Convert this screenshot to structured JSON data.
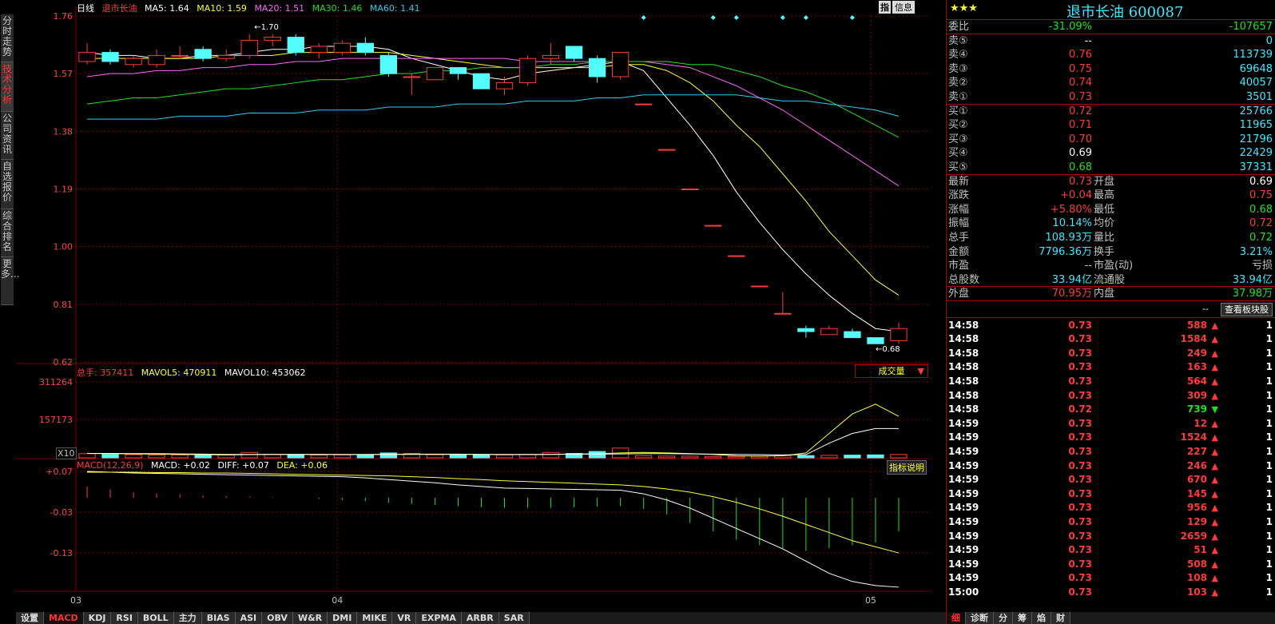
{
  "left_tabs": [
    {
      "label": "分时走势",
      "active": false
    },
    {
      "label": "技术分析",
      "active": true
    },
    {
      "label": "公司资讯",
      "active": false
    },
    {
      "label": "自选报价",
      "active": false
    },
    {
      "label": "综合排名",
      "active": false
    },
    {
      "label": "更多...",
      "active": false
    }
  ],
  "main_legend": {
    "period": "日线",
    "name": "退市长油",
    "ma5": "MA5: 1.64",
    "ma10": "MA10: 1.59",
    "ma20": "MA20: 1.51",
    "ma30": "MA30: 1.46",
    "ma60": "MA60: 1.41"
  },
  "toolbar": {
    "zhi_label": "指",
    "info_label": "信息"
  },
  "vol_legend": {
    "total": "总手: 357411",
    "mavol5": "MAVOL5: 470911",
    "mavol10": "MAVOL10: 453062",
    "dropdown": "成交量",
    "x10": "X10"
  },
  "macd_legend": {
    "params": "MACD(12,26,9)",
    "macd": "MACD: +0.02",
    "diff": "DIFF: +0.07",
    "dea": "DEA: +0.06",
    "help_button": "指标说明"
  },
  "annotations": {
    "high": "←1.70",
    "low": "←0.68"
  },
  "colors": {
    "up": "#ff3b3b",
    "down": "#54fcfc",
    "ma5": "#ffffff",
    "ma10": "#ffff33",
    "ma20": "#ff66ff",
    "ma30": "#22e022",
    "ma60": "#33ccee",
    "grid": "#800000"
  },
  "chart_data": [
    {
      "type": "candlestick",
      "yaxis_ticks": [
        "1.76",
        "1.57",
        "1.38",
        "1.19",
        "1.00",
        "0.81",
        "0.62"
      ],
      "ylim": [
        0.62,
        1.76
      ],
      "xaxis_ticks": [
        "03",
        "04",
        "05"
      ],
      "candles": [
        {
          "o": 1.61,
          "c": 1.64,
          "h": 1.67,
          "l": 1.6
        },
        {
          "o": 1.64,
          "c": 1.61,
          "h": 1.65,
          "l": 1.6
        },
        {
          "o": 1.6,
          "c": 1.62,
          "h": 1.63,
          "l": 1.59
        },
        {
          "o": 1.6,
          "c": 1.63,
          "h": 1.65,
          "l": 1.59
        },
        {
          "o": 1.63,
          "c": 1.63,
          "h": 1.66,
          "l": 1.62
        },
        {
          "o": 1.65,
          "c": 1.62,
          "h": 1.66,
          "l": 1.61
        },
        {
          "o": 1.62,
          "c": 1.63,
          "h": 1.65,
          "l": 1.61
        },
        {
          "o": 1.63,
          "c": 1.68,
          "h": 1.7,
          "l": 1.62
        },
        {
          "o": 1.68,
          "c": 1.69,
          "h": 1.7,
          "l": 1.66
        },
        {
          "o": 1.69,
          "c": 1.64,
          "h": 1.7,
          "l": 1.63
        },
        {
          "o": 1.64,
          "c": 1.66,
          "h": 1.67,
          "l": 1.62
        },
        {
          "o": 1.64,
          "c": 1.67,
          "h": 1.68,
          "l": 1.63
        },
        {
          "o": 1.67,
          "c": 1.64,
          "h": 1.69,
          "l": 1.63
        },
        {
          "o": 1.63,
          "c": 1.57,
          "h": 1.64,
          "l": 1.56
        },
        {
          "o": 1.56,
          "c": 1.56,
          "h": 1.57,
          "l": 1.5
        },
        {
          "o": 1.55,
          "c": 1.59,
          "h": 1.59,
          "l": 1.55
        },
        {
          "o": 1.59,
          "c": 1.57,
          "h": 1.59,
          "l": 1.55
        },
        {
          "o": 1.57,
          "c": 1.52,
          "h": 1.57,
          "l": 1.52
        },
        {
          "o": 1.52,
          "c": 1.54,
          "h": 1.56,
          "l": 1.5
        },
        {
          "o": 1.54,
          "c": 1.62,
          "h": 1.63,
          "l": 1.53
        },
        {
          "o": 1.62,
          "c": 1.63,
          "h": 1.67,
          "l": 1.6
        },
        {
          "o": 1.66,
          "c": 1.62,
          "h": 1.66,
          "l": 1.61
        },
        {
          "o": 1.62,
          "c": 1.56,
          "h": 1.63,
          "l": 1.54
        },
        {
          "o": 1.56,
          "c": 1.64,
          "h": 1.64,
          "l": 1.55
        },
        {
          "o": 1.47,
          "c": 1.47,
          "h": 1.47,
          "l": 1.47
        },
        {
          "o": 1.32,
          "c": 1.32,
          "h": 1.32,
          "l": 1.32
        },
        {
          "o": 1.19,
          "c": 1.19,
          "h": 1.19,
          "l": 1.19
        },
        {
          "o": 1.07,
          "c": 1.07,
          "h": 1.07,
          "l": 1.07
        },
        {
          "o": 0.97,
          "c": 0.97,
          "h": 0.97,
          "l": 0.97
        },
        {
          "o": 0.87,
          "c": 0.87,
          "h": 0.87,
          "l": 0.87
        },
        {
          "o": 0.78,
          "c": 0.78,
          "h": 0.85,
          "l": 0.78
        },
        {
          "o": 0.73,
          "c": 0.72,
          "h": 0.74,
          "l": 0.7
        },
        {
          "o": 0.71,
          "c": 0.73,
          "h": 0.74,
          "l": 0.71
        },
        {
          "o": 0.72,
          "c": 0.7,
          "h": 0.73,
          "l": 0.7
        },
        {
          "o": 0.7,
          "c": 0.68,
          "h": 0.7,
          "l": 0.68
        },
        {
          "o": 0.69,
          "c": 0.73,
          "h": 0.75,
          "l": 0.68
        }
      ],
      "series": [
        {
          "name": "MA5",
          "values": [
            1.64,
            1.63,
            1.63,
            1.62,
            1.62,
            1.63,
            1.63,
            1.64,
            1.65,
            1.65,
            1.66,
            1.66,
            1.66,
            1.65,
            1.62,
            1.6,
            1.58,
            1.56,
            1.55,
            1.57,
            1.58,
            1.59,
            1.6,
            1.61,
            1.58,
            1.49,
            1.4,
            1.3,
            1.18,
            1.08,
            0.99,
            0.91,
            0.84,
            0.78,
            0.73,
            0.72
          ]
        },
        {
          "name": "MA10",
          "values": [
            1.62,
            1.62,
            1.62,
            1.62,
            1.62,
            1.62,
            1.63,
            1.63,
            1.63,
            1.64,
            1.64,
            1.64,
            1.64,
            1.64,
            1.63,
            1.62,
            1.61,
            1.6,
            1.59,
            1.59,
            1.59,
            1.59,
            1.59,
            1.6,
            1.6,
            1.58,
            1.54,
            1.48,
            1.4,
            1.33,
            1.24,
            1.15,
            1.05,
            0.97,
            0.89,
            0.84
          ]
        },
        {
          "name": "MA20",
          "values": [
            1.56,
            1.57,
            1.57,
            1.58,
            1.58,
            1.59,
            1.59,
            1.6,
            1.6,
            1.61,
            1.61,
            1.62,
            1.62,
            1.62,
            1.62,
            1.62,
            1.62,
            1.62,
            1.62,
            1.61,
            1.61,
            1.61,
            1.61,
            1.61,
            1.61,
            1.6,
            1.59,
            1.56,
            1.53,
            1.49,
            1.45,
            1.4,
            1.35,
            1.3,
            1.25,
            1.2
          ]
        },
        {
          "name": "MA30",
          "values": [
            1.47,
            1.48,
            1.49,
            1.49,
            1.5,
            1.51,
            1.52,
            1.52,
            1.53,
            1.54,
            1.55,
            1.55,
            1.56,
            1.57,
            1.57,
            1.58,
            1.58,
            1.59,
            1.59,
            1.59,
            1.6,
            1.6,
            1.61,
            1.61,
            1.61,
            1.61,
            1.6,
            1.6,
            1.58,
            1.56,
            1.53,
            1.51,
            1.48,
            1.44,
            1.4,
            1.36
          ]
        },
        {
          "name": "MA60",
          "values": [
            1.42,
            1.42,
            1.42,
            1.42,
            1.43,
            1.43,
            1.43,
            1.44,
            1.44,
            1.44,
            1.45,
            1.45,
            1.45,
            1.46,
            1.46,
            1.46,
            1.47,
            1.47,
            1.47,
            1.48,
            1.48,
            1.48,
            1.49,
            1.49,
            1.5,
            1.5,
            1.5,
            1.5,
            1.5,
            1.49,
            1.48,
            1.48,
            1.47,
            1.46,
            1.45,
            1.43
          ]
        }
      ]
    },
    {
      "type": "bar",
      "yaxis_ticks": [
        "311264",
        "157173"
      ],
      "ylim": [
        0,
        311264
      ],
      "values": [
        17000,
        14000,
        13000,
        11000,
        12000,
        10000,
        12000,
        22000,
        14000,
        13000,
        11000,
        12000,
        13000,
        20000,
        18000,
        13000,
        12000,
        12000,
        12000,
        14000,
        22000,
        18000,
        26000,
        40000,
        9000,
        7000,
        7000,
        6000,
        6000,
        7000,
        9000,
        9000,
        10000,
        11000,
        12000,
        14000
      ],
      "series": [
        {
          "name": "MAVOL5",
          "values": [
            18000,
            17000,
            16000,
            15000,
            14000,
            13000,
            12000,
            13000,
            14000,
            14000,
            14000,
            13000,
            13000,
            14000,
            15000,
            15000,
            15000,
            14000,
            13000,
            13000,
            14000,
            15000,
            17000,
            20000,
            22000,
            20000,
            17000,
            14000,
            8000,
            7000,
            8000,
            20000,
            100000,
            180000,
            220000,
            170000
          ]
        },
        {
          "name": "MAVOL10",
          "values": [
            18000,
            18000,
            17000,
            17000,
            16000,
            15000,
            14000,
            14000,
            14000,
            14000,
            14000,
            14000,
            14000,
            14000,
            14000,
            14000,
            14000,
            14000,
            14000,
            14000,
            14000,
            15000,
            15000,
            16000,
            17000,
            17000,
            16000,
            15000,
            14000,
            13000,
            12000,
            13000,
            60000,
            100000,
            120000,
            120000
          ]
        }
      ]
    },
    {
      "type": "line",
      "yaxis_ticks": [
        "+0.07",
        "-0.03",
        "-0.13"
      ],
      "ylim": [
        -0.22,
        0.07
      ],
      "series": [
        {
          "name": "DIFF",
          "values": [
            0.07,
            0.068,
            0.066,
            0.065,
            0.064,
            0.063,
            0.062,
            0.061,
            0.06,
            0.059,
            0.058,
            0.057,
            0.054,
            0.05,
            0.046,
            0.042,
            0.037,
            0.033,
            0.029,
            0.028,
            0.027,
            0.026,
            0.025,
            0.024,
            0.015,
            0.0,
            -0.02,
            -0.045,
            -0.07,
            -0.095,
            -0.12,
            -0.15,
            -0.18,
            -0.2,
            -0.21,
            -0.214
          ]
        },
        {
          "name": "DEA",
          "values": [
            0.068,
            0.068,
            0.068,
            0.067,
            0.067,
            0.066,
            0.066,
            0.065,
            0.064,
            0.063,
            0.062,
            0.061,
            0.06,
            0.059,
            0.057,
            0.055,
            0.052,
            0.05,
            0.047,
            0.045,
            0.043,
            0.041,
            0.039,
            0.037,
            0.033,
            0.027,
            0.019,
            0.008,
            -0.006,
            -0.022,
            -0.04,
            -0.06,
            -0.08,
            -0.1,
            -0.115,
            -0.13
          ]
        }
      ],
      "histogram": [
        0.02,
        0.015,
        0.01,
        0.008,
        0.006,
        0.004,
        0.003,
        0.002,
        0.001,
        0.0,
        -0.002,
        -0.004,
        -0.006,
        -0.009,
        -0.011,
        -0.013,
        -0.015,
        -0.017,
        -0.018,
        -0.018,
        -0.018,
        -0.017,
        -0.016,
        -0.015,
        -0.02,
        -0.03,
        -0.045,
        -0.06,
        -0.075,
        -0.085,
        -0.09,
        -0.095,
        -0.09,
        -0.085,
        -0.08,
        -0.06
      ]
    }
  ],
  "quote": {
    "stars": "★★★",
    "title": "退市长油 600087",
    "weibi_label": "委比",
    "weibi_pct": "-31.09%",
    "weibi_val": "-107657",
    "asks": [
      {
        "label": "卖⑤",
        "price": "--",
        "vol": "0"
      },
      {
        "label": "卖④",
        "price": "0.76",
        "vol": "113739"
      },
      {
        "label": "卖③",
        "price": "0.75",
        "vol": "69648"
      },
      {
        "label": "卖②",
        "price": "0.74",
        "vol": "40057"
      },
      {
        "label": "卖①",
        "price": "0.73",
        "vol": "3501"
      }
    ],
    "bids": [
      {
        "label": "买①",
        "price": "0.72",
        "vol": "25766",
        "color": "red"
      },
      {
        "label": "买②",
        "price": "0.71",
        "vol": "11965",
        "color": "red"
      },
      {
        "label": "买③",
        "price": "0.70",
        "vol": "21796",
        "color": "red"
      },
      {
        "label": "买④",
        "price": "0.69",
        "vol": "22429",
        "color": "white"
      },
      {
        "label": "买⑤",
        "price": "0.68",
        "vol": "37331",
        "color": "green"
      }
    ],
    "stats": [
      {
        "l1": "最新",
        "v1": "0.73",
        "c1": "red",
        "l2": "开盘",
        "v2": "0.69",
        "c2": "white"
      },
      {
        "l1": "涨跌",
        "v1": "+0.04",
        "c1": "red",
        "l2": "最高",
        "v2": "0.75",
        "c2": "red"
      },
      {
        "l1": "涨幅",
        "v1": "+5.80%",
        "c1": "red",
        "l2": "最低",
        "v2": "0.68",
        "c2": "green"
      },
      {
        "l1": "振幅",
        "v1": "10.14%",
        "c1": "cyan",
        "l2": "均价",
        "v2": "0.72",
        "c2": "red"
      },
      {
        "l1": "总手",
        "v1": "108.93万",
        "c1": "cyan",
        "l2": "量比",
        "v2": "0.72",
        "c2": "green"
      },
      {
        "l1": "金额",
        "v1": "7796.36万",
        "c1": "cyan",
        "l2": "换手",
        "v2": "3.21%",
        "c2": "cyan"
      },
      {
        "l1": "市盈",
        "v1": "--",
        "c1": "gray",
        "l2": "市盈(动)",
        "v2": "亏损",
        "c2": "gray"
      },
      {
        "l1": "总股数",
        "v1": "33.94亿",
        "c1": "cyan",
        "l2": "流通股",
        "v2": "33.94亿",
        "c2": "cyan"
      }
    ],
    "waipan_label": "外盘",
    "waipan_val": "70.95万",
    "neipan_label": "内盘",
    "neipan_val": "37.98万",
    "dash": "--",
    "sector_button": "查看板块股"
  },
  "ticks": [
    {
      "t": "14:58",
      "p": "0.73",
      "v": "588",
      "d": "up",
      "n": "1"
    },
    {
      "t": "14:58",
      "p": "0.73",
      "v": "1584",
      "d": "up",
      "n": "1"
    },
    {
      "t": "14:58",
      "p": "0.73",
      "v": "249",
      "d": "up",
      "n": "1"
    },
    {
      "t": "14:58",
      "p": "0.73",
      "v": "163",
      "d": "up",
      "n": "1"
    },
    {
      "t": "14:58",
      "p": "0.73",
      "v": "564",
      "d": "up",
      "n": "1"
    },
    {
      "t": "14:58",
      "p": "0.73",
      "v": "309",
      "d": "up",
      "n": "1"
    },
    {
      "t": "14:58",
      "p": "0.72",
      "v": "739",
      "d": "down",
      "n": "1"
    },
    {
      "t": "14:59",
      "p": "0.73",
      "v": "12",
      "d": "up",
      "n": "1"
    },
    {
      "t": "14:59",
      "p": "0.73",
      "v": "1524",
      "d": "up",
      "n": "1"
    },
    {
      "t": "14:59",
      "p": "0.73",
      "v": "227",
      "d": "up",
      "n": "1"
    },
    {
      "t": "14:59",
      "p": "0.73",
      "v": "246",
      "d": "up",
      "n": "1"
    },
    {
      "t": "14:59",
      "p": "0.73",
      "v": "670",
      "d": "up",
      "n": "1"
    },
    {
      "t": "14:59",
      "p": "0.73",
      "v": "145",
      "d": "up",
      "n": "1"
    },
    {
      "t": "14:59",
      "p": "0.73",
      "v": "956",
      "d": "up",
      "n": "1"
    },
    {
      "t": "14:59",
      "p": "0.73",
      "v": "129",
      "d": "up",
      "n": "1"
    },
    {
      "t": "14:59",
      "p": "0.73",
      "v": "2659",
      "d": "up",
      "n": "1"
    },
    {
      "t": "14:59",
      "p": "0.73",
      "v": "51",
      "d": "up",
      "n": "1"
    },
    {
      "t": "14:59",
      "p": "0.73",
      "v": "508",
      "d": "up",
      "n": "1"
    },
    {
      "t": "14:59",
      "p": "0.73",
      "v": "108",
      "d": "up",
      "n": "1"
    },
    {
      "t": "15:00",
      "p": "0.73",
      "v": "103",
      "d": "up",
      "n": "1"
    }
  ],
  "bottom_tabs": [
    {
      "label": "设置",
      "active": false
    },
    {
      "label": "MACD",
      "active": true
    },
    {
      "label": "KDJ",
      "active": false
    },
    {
      "label": "RSI",
      "active": false
    },
    {
      "label": "BOLL",
      "active": false
    },
    {
      "label": "主力",
      "active": false
    },
    {
      "label": "BIAS",
      "active": false
    },
    {
      "label": "ASI",
      "active": false
    },
    {
      "label": "OBV",
      "active": false
    },
    {
      "label": "W&R",
      "active": false
    },
    {
      "label": "DMI",
      "active": false
    },
    {
      "label": "MIKE",
      "active": false
    },
    {
      "label": "VR",
      "active": false
    },
    {
      "label": "EXPMA",
      "active": false
    },
    {
      "label": "ARBR",
      "active": false
    },
    {
      "label": "SAR",
      "active": false
    }
  ],
  "right_tabs": [
    {
      "label": "细",
      "active": true
    },
    {
      "label": "诊断",
      "active": false
    },
    {
      "label": "分",
      "active": false
    },
    {
      "label": "筹",
      "active": false
    },
    {
      "label": "焰",
      "active": false
    },
    {
      "label": "财",
      "active": false
    }
  ]
}
